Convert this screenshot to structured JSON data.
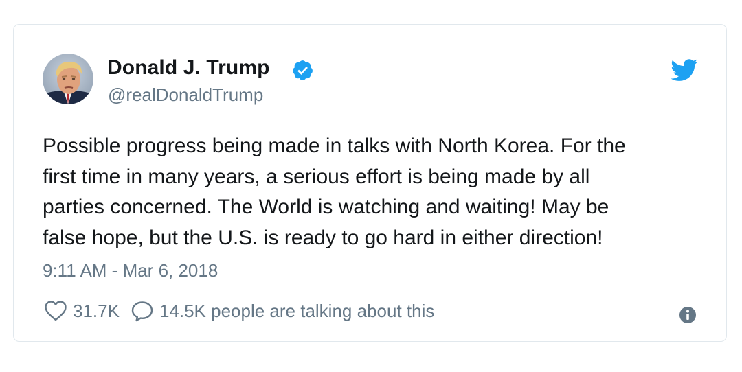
{
  "author": {
    "name": "Donald J. Trump",
    "handle": "@realDonaldTrump",
    "verified": true,
    "avatar_icon": "profile-photo"
  },
  "tweet": {
    "lines": [
      "Possible progress being made in talks with North Korea. For the",
      "first time in many years, a serious effort is being made by all",
      "parties concerned. The World is watching and waiting! May be",
      "false hope, but the U.S. is ready to go hard in either direction!"
    ],
    "timestamp": "9:11 AM - Mar 6, 2018"
  },
  "stats": {
    "likes": "31.7K",
    "talking": "14.5K people are talking about this"
  },
  "icons": {
    "brand": "twitter-bird-icon",
    "verified": "verified-badge-icon",
    "like": "heart-icon",
    "reply": "speech-bubble-icon",
    "info": "info-icon"
  },
  "colors": {
    "brand_blue": "#1da1f2",
    "text_primary": "#14171a",
    "text_secondary": "#657786",
    "border": "#e1e8ed"
  }
}
